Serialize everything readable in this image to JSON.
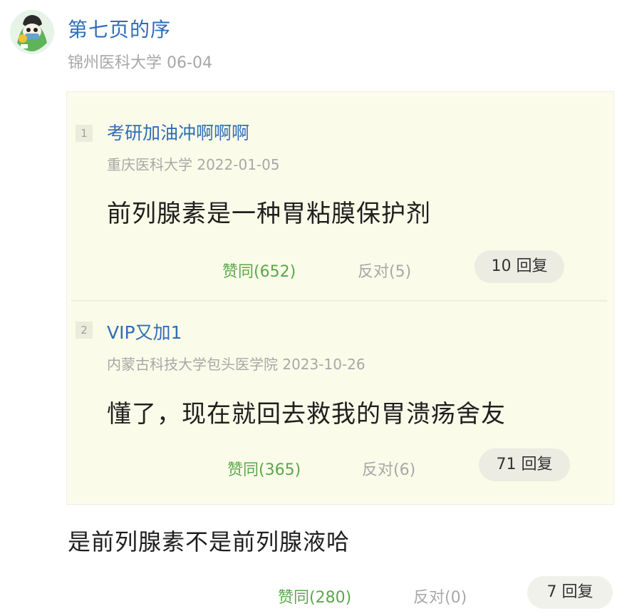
{
  "comment": {
    "author": "第七页的序",
    "school": "锦州医科大学",
    "date": "06-04",
    "text": "是前列腺素不是前列腺液哈",
    "agree": "赞同(280)",
    "oppose": "反对(0)",
    "replies": "7 回复"
  },
  "quotes": [
    {
      "floor": "1",
      "author": "考研加油冲啊啊啊",
      "meta": "重庆医科大学 2022-01-05",
      "text": "前列腺素是一种胃粘膜保护剂",
      "agree": "赞同(652)",
      "oppose": "反对(5)",
      "replies": "10 回复"
    },
    {
      "floor": "2",
      "author": "VIP又加1",
      "meta": "内蒙古科技大学包头医学院 2023-10-26",
      "text": "懂了，现在就回去救我的胃溃疡舍友",
      "agree": "赞同(365)",
      "oppose": "反对(6)",
      "replies": "71 回复"
    }
  ],
  "colors": {
    "link": "#2f6db8",
    "agree": "#5aa84a",
    "muted": "#a8a8a8",
    "quote_bg": "#fbfbe9"
  },
  "icons": {
    "avatar": "cartoon-avatar-icon"
  }
}
